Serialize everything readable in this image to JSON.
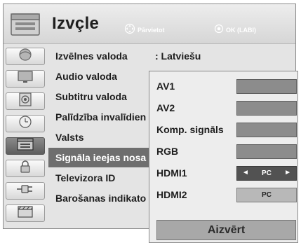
{
  "header": {
    "title": "Izvçle",
    "nav_hint": "Pārvietot",
    "ok_hint": "OK (LABI)",
    "icon": "settings-box-icon"
  },
  "sidebar": {
    "items": [
      {
        "icon": "picture-icon",
        "active": false
      },
      {
        "icon": "monitor-icon",
        "active": false
      },
      {
        "icon": "speaker-icon",
        "active": false
      },
      {
        "icon": "clock-icon",
        "active": false
      },
      {
        "icon": "settings-box-icon",
        "active": true
      },
      {
        "icon": "lock-icon",
        "active": false
      },
      {
        "icon": "plug-icon",
        "active": false
      },
      {
        "icon": "film-icon",
        "active": false
      }
    ]
  },
  "menu": {
    "rows": [
      {
        "label": "Izvēlnes valoda",
        "value": ": Latviešu"
      },
      {
        "label": "Audio valoda",
        "value": ""
      },
      {
        "label": "Subtitru valoda",
        "value": ""
      },
      {
        "label": "Palīdzība invalīdien",
        "value": ""
      },
      {
        "label": "Valsts",
        "value": ""
      },
      {
        "label": "Signāla ieejas nosa",
        "value": ""
      },
      {
        "label": "Televizora ID",
        "value": ""
      },
      {
        "label": "Barošanas indikato",
        "value": ""
      }
    ],
    "active_index": 5
  },
  "popup": {
    "sources": [
      {
        "label": "AV1",
        "value": ""
      },
      {
        "label": "AV2",
        "value": ""
      },
      {
        "label": "Komp. signāls",
        "value": ""
      },
      {
        "label": "RGB",
        "value": ""
      },
      {
        "label": "HDMI1",
        "value": "PC",
        "arrows": true
      },
      {
        "label": "HDMI2",
        "value": "PC"
      }
    ],
    "close_label": "Aizvērt"
  },
  "colors": {
    "panel_bg": "#e4e4e4",
    "highlight": "#6e6e6e",
    "selected_box": "#525252"
  }
}
